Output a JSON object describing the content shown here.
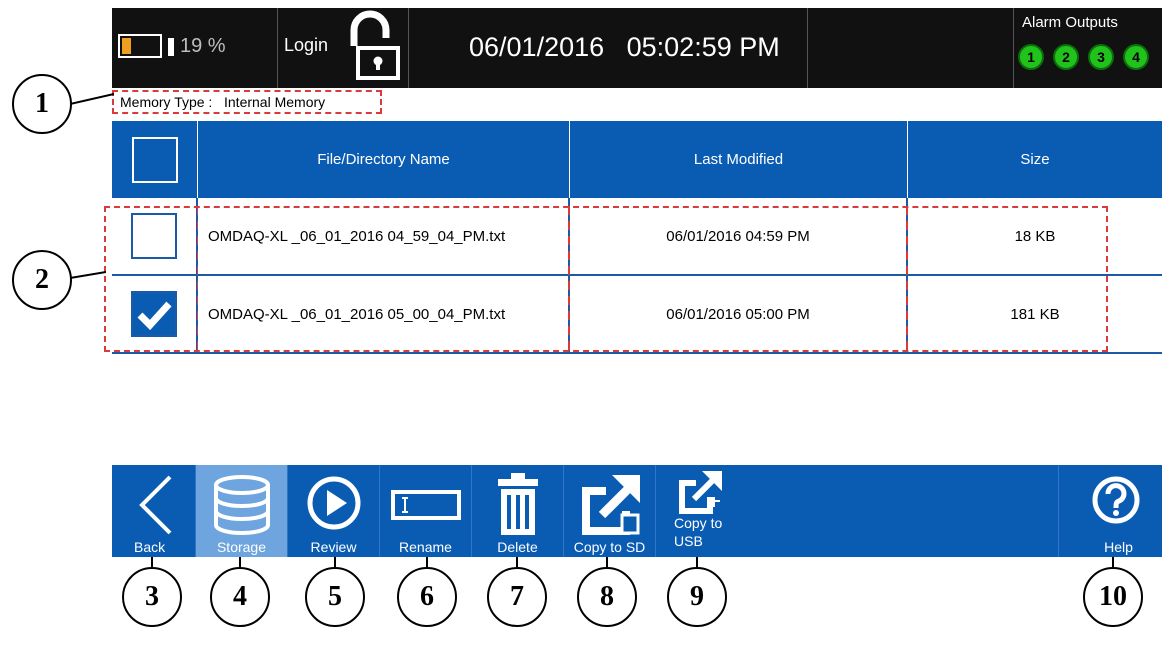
{
  "status_bar": {
    "battery_percent_label": "19 %",
    "battery_level": 0.19,
    "login_label": "Login",
    "datetime": "06/01/2016   05:02:59 PM",
    "alarm_title": "Alarm Outputs",
    "alarm_outputs": [
      "1",
      "2",
      "3",
      "4"
    ],
    "alarm_color": "#22c21c",
    "battery_color": "#f0a020"
  },
  "memory_type": {
    "label": "Memory Type :",
    "value": "Internal Memory"
  },
  "table": {
    "columns": [
      "File/Directory Name",
      "Last Modified",
      "Size"
    ],
    "rows": [
      {
        "checked": false,
        "name": "OMDAQ-XL _06_01_2016 04_59_04_PM.txt",
        "modified": "06/01/2016  04:59 PM",
        "size": "18 KB"
      },
      {
        "checked": true,
        "name": "OMDAQ-XL _06_01_2016 05_00_04_PM.txt",
        "modified": "06/01/2016  05:00 PM",
        "size": "181 KB"
      }
    ]
  },
  "toolbar": {
    "back": "Back",
    "storage": "Storage",
    "review": "Review",
    "rename": "Rename",
    "delete": "Delete",
    "copy_sd": "Copy to SD",
    "copy_usb_line1": "Copy to",
    "copy_usb_line2": "USB",
    "help": "Help",
    "active": "storage",
    "color": "#0a5cb3"
  },
  "callouts": [
    "1",
    "2",
    "3",
    "4",
    "5",
    "6",
    "7",
    "8",
    "9",
    "10"
  ]
}
